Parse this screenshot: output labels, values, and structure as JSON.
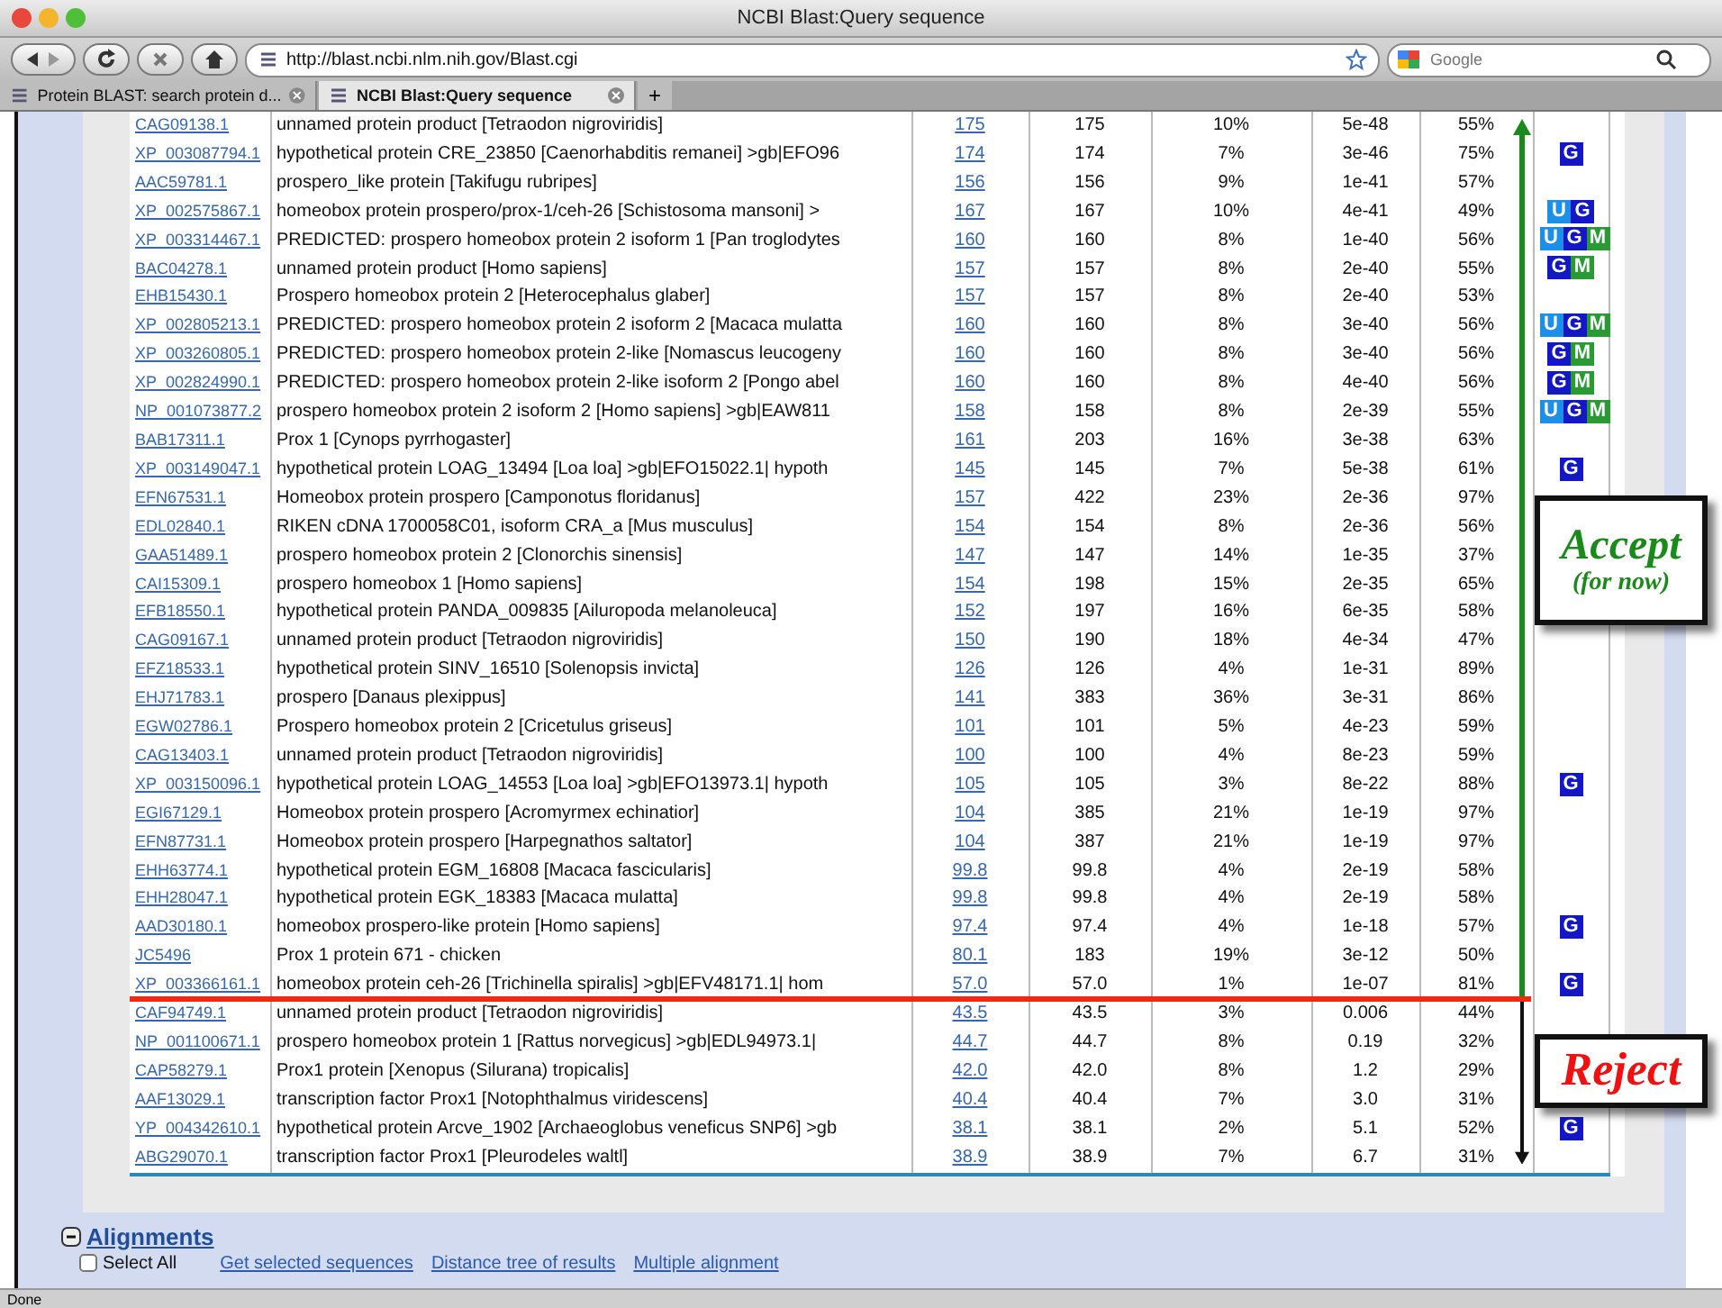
{
  "window": {
    "title": "NCBI Blast:Query sequence"
  },
  "toolbar": {
    "url": "http://blast.ncbi.nlm.nih.gov/Blast.cgi",
    "search_placeholder": "Google"
  },
  "tabs": [
    {
      "label": "Protein BLAST: search protein d...",
      "selected": false
    },
    {
      "label": "NCBI Blast:Query sequence",
      "selected": true
    }
  ],
  "new_tab": "+",
  "groups": [
    {
      "kind": "accept",
      "label": "Accept",
      "note": "(for now)",
      "rows": [
        {
          "accession": "CAG09138.1",
          "description": "unnamed protein product [Tetraodon nigroviridis]",
          "max_score": "175",
          "total_score": "175",
          "coverage": "10%",
          "evalue": "5e-48",
          "ident": "55%",
          "links": []
        },
        {
          "accession": "XP_003087794.1",
          "description": "hypothetical protein CRE_23850 [Caenorhabditis remanei] >gb|EFO96",
          "max_score": "174",
          "total_score": "174",
          "coverage": "7%",
          "evalue": "3e-46",
          "ident": "75%",
          "links": [
            {
              "kind": "gene",
              "label": "G"
            }
          ]
        },
        {
          "accession": "AAC59781.1",
          "description": "prospero_like protein [Takifugu rubripes]",
          "max_score": "156",
          "total_score": "156",
          "coverage": "9%",
          "evalue": "1e-41",
          "ident": "57%",
          "links": []
        },
        {
          "accession": "XP_002575867.1",
          "description": "homeobox protein prospero/prox-1/ceh-26 [Schistosoma mansoni] >",
          "max_score": "167",
          "total_score": "167",
          "coverage": "10%",
          "evalue": "4e-41",
          "ident": "49%",
          "links": [
            {
              "kind": "unigene",
              "label": "U"
            },
            {
              "kind": "gene",
              "label": "G"
            }
          ]
        },
        {
          "accession": "XP_003314467.1",
          "description": "PREDICTED: prospero homeobox protein 2 isoform 1 [Pan troglodytes",
          "max_score": "160",
          "total_score": "160",
          "coverage": "8%",
          "evalue": "1e-40",
          "ident": "56%",
          "links": [
            {
              "kind": "unigene",
              "label": "U"
            },
            {
              "kind": "gene",
              "label": "G"
            },
            {
              "kind": "map",
              "label": "M"
            }
          ]
        },
        {
          "accession": "BAC04278.1",
          "description": "unnamed protein product [Homo sapiens]",
          "max_score": "157",
          "total_score": "157",
          "coverage": "8%",
          "evalue": "2e-40",
          "ident": "55%",
          "links": [
            {
              "kind": "gene",
              "label": "G"
            },
            {
              "kind": "map",
              "label": "M"
            }
          ]
        },
        {
          "accession": "EHB15430.1",
          "description": "Prospero homeobox protein 2 [Heterocephalus glaber]",
          "max_score": "157",
          "total_score": "157",
          "coverage": "8%",
          "evalue": "2e-40",
          "ident": "53%",
          "links": []
        },
        {
          "accession": "XP_002805213.1",
          "description": "PREDICTED: prospero homeobox protein 2 isoform 2 [Macaca mulatta",
          "max_score": "160",
          "total_score": "160",
          "coverage": "8%",
          "evalue": "3e-40",
          "ident": "56%",
          "links": [
            {
              "kind": "unigene",
              "label": "U"
            },
            {
              "kind": "gene",
              "label": "G"
            },
            {
              "kind": "map",
              "label": "M"
            }
          ]
        },
        {
          "accession": "XP_003260805.1",
          "description": "PREDICTED: prospero homeobox protein 2-like [Nomascus leucogeny",
          "max_score": "160",
          "total_score": "160",
          "coverage": "8%",
          "evalue": "3e-40",
          "ident": "56%",
          "links": [
            {
              "kind": "gene",
              "label": "G"
            },
            {
              "kind": "map",
              "label": "M"
            }
          ]
        },
        {
          "accession": "XP_002824990.1",
          "description": "PREDICTED: prospero homeobox protein 2-like isoform 2 [Pongo abel",
          "max_score": "160",
          "total_score": "160",
          "coverage": "8%",
          "evalue": "4e-40",
          "ident": "56%",
          "links": [
            {
              "kind": "gene",
              "label": "G"
            },
            {
              "kind": "map",
              "label": "M"
            }
          ]
        },
        {
          "accession": "NP_001073877.2",
          "description": "prospero homeobox protein 2 isoform 2 [Homo sapiens] >gb|EAW811",
          "max_score": "158",
          "total_score": "158",
          "coverage": "8%",
          "evalue": "2e-39",
          "ident": "55%",
          "links": [
            {
              "kind": "unigene",
              "label": "U"
            },
            {
              "kind": "gene",
              "label": "G"
            },
            {
              "kind": "map",
              "label": "M"
            }
          ]
        },
        {
          "accession": "BAB17311.1",
          "description": "Prox 1 [Cynops pyrrhogaster]",
          "max_score": "161",
          "total_score": "203",
          "coverage": "16%",
          "evalue": "3e-38",
          "ident": "63%",
          "links": []
        },
        {
          "accession": "XP_003149047.1",
          "description": "hypothetical protein LOAG_13494 [Loa loa] >gb|EFO15022.1| hypoth",
          "max_score": "145",
          "total_score": "145",
          "coverage": "7%",
          "evalue": "5e-38",
          "ident": "61%",
          "links": [
            {
              "kind": "gene",
              "label": "G"
            }
          ]
        },
        {
          "accession": "EFN67531.1",
          "description": "Homeobox protein prospero [Camponotus floridanus]",
          "max_score": "157",
          "total_score": "422",
          "coverage": "23%",
          "evalue": "2e-36",
          "ident": "97%",
          "links": []
        },
        {
          "accession": "EDL02840.1",
          "description": "RIKEN cDNA 1700058C01, isoform CRA_a [Mus musculus]",
          "max_score": "154",
          "total_score": "154",
          "coverage": "8%",
          "evalue": "2e-36",
          "ident": "56%",
          "links": []
        },
        {
          "accession": "GAA51489.1",
          "description": "prospero homeobox protein 2 [Clonorchis sinensis]",
          "max_score": "147",
          "total_score": "147",
          "coverage": "14%",
          "evalue": "1e-35",
          "ident": "37%",
          "links": []
        },
        {
          "accession": "CAI15309.1",
          "description": "prospero homeobox 1 [Homo sapiens]",
          "max_score": "154",
          "total_score": "198",
          "coverage": "15%",
          "evalue": "2e-35",
          "ident": "65%",
          "links": []
        },
        {
          "accession": "EFB18550.1",
          "description": "hypothetical protein PANDA_009835 [Ailuropoda melanoleuca]",
          "max_score": "152",
          "total_score": "197",
          "coverage": "16%",
          "evalue": "6e-35",
          "ident": "58%",
          "links": []
        },
        {
          "accession": "CAG09167.1",
          "description": "unnamed protein product [Tetraodon nigroviridis]",
          "max_score": "150",
          "total_score": "190",
          "coverage": "18%",
          "evalue": "4e-34",
          "ident": "47%",
          "links": []
        },
        {
          "accession": "EFZ18533.1",
          "description": "hypothetical protein SINV_16510 [Solenopsis invicta]",
          "max_score": "126",
          "total_score": "126",
          "coverage": "4%",
          "evalue": "1e-31",
          "ident": "89%",
          "links": []
        },
        {
          "accession": "EHJ71783.1",
          "description": "prospero [Danaus plexippus]",
          "max_score": "141",
          "total_score": "383",
          "coverage": "36%",
          "evalue": "3e-31",
          "ident": "86%",
          "links": []
        },
        {
          "accession": "EGW02786.1",
          "description": "Prospero homeobox protein 2 [Cricetulus griseus]",
          "max_score": "101",
          "total_score": "101",
          "coverage": "5%",
          "evalue": "4e-23",
          "ident": "59%",
          "links": []
        },
        {
          "accession": "CAG13403.1",
          "description": "unnamed protein product [Tetraodon nigroviridis]",
          "max_score": "100",
          "total_score": "100",
          "coverage": "4%",
          "evalue": "8e-23",
          "ident": "59%",
          "links": []
        },
        {
          "accession": "XP_003150096.1",
          "description": "hypothetical protein LOAG_14553 [Loa loa] >gb|EFO13973.1| hypoth",
          "max_score": "105",
          "total_score": "105",
          "coverage": "3%",
          "evalue": "8e-22",
          "ident": "88%",
          "links": [
            {
              "kind": "gene",
              "label": "G"
            }
          ]
        },
        {
          "accession": "EGI67129.1",
          "description": "Homeobox protein prospero [Acromyrmex echinatior]",
          "max_score": "104",
          "total_score": "385",
          "coverage": "21%",
          "evalue": "1e-19",
          "ident": "97%",
          "links": []
        },
        {
          "accession": "EFN87731.1",
          "description": "Homeobox protein prospero [Harpegnathos saltator]",
          "max_score": "104",
          "total_score": "387",
          "coverage": "21%",
          "evalue": "1e-19",
          "ident": "97%",
          "links": []
        },
        {
          "accession": "EHH63774.1",
          "description": "hypothetical protein EGM_16808 [Macaca fascicularis]",
          "max_score": "99.8",
          "total_score": "99.8",
          "coverage": "4%",
          "evalue": "2e-19",
          "ident": "58%",
          "links": []
        },
        {
          "accession": "EHH28047.1",
          "description": "hypothetical protein EGK_18383 [Macaca mulatta]",
          "max_score": "99.8",
          "total_score": "99.8",
          "coverage": "4%",
          "evalue": "2e-19",
          "ident": "58%",
          "links": []
        },
        {
          "accession": "AAD30180.1",
          "description": "homeobox prospero-like protein [Homo sapiens]",
          "max_score": "97.4",
          "total_score": "97.4",
          "coverage": "4%",
          "evalue": "1e-18",
          "ident": "57%",
          "links": [
            {
              "kind": "gene",
              "label": "G"
            }
          ]
        },
        {
          "accession": "JC5496",
          "description": "Prox 1 protein 671 - chicken",
          "max_score": "80.1",
          "total_score": "183",
          "coverage": "19%",
          "evalue": "3e-12",
          "ident": "50%",
          "links": []
        },
        {
          "accession": "XP_003366161.1",
          "description": "homeobox protein ceh-26 [Trichinella spiralis] >gb|EFV48171.1| hom",
          "max_score": "57.0",
          "total_score": "57.0",
          "coverage": "1%",
          "evalue": "1e-07",
          "ident": "81%",
          "links": [
            {
              "kind": "gene",
              "label": "G"
            }
          ]
        }
      ]
    },
    {
      "kind": "reject",
      "label": "Reject",
      "rows": [
        {
          "accession": "CAF94749.1",
          "description": "unnamed protein product [Tetraodon nigroviridis]",
          "max_score": "43.5",
          "total_score": "43.5",
          "coverage": "3%",
          "evalue": "0.006",
          "ident": "44%",
          "links": []
        },
        {
          "accession": "NP_001100671.1",
          "description": "prospero homeobox protein 1 [Rattus norvegicus] >gb|EDL94973.1|",
          "max_score": "44.7",
          "total_score": "44.7",
          "coverage": "8%",
          "evalue": "0.19",
          "ident": "32%",
          "links": []
        },
        {
          "accession": "CAP58279.1",
          "description": "Prox1 protein [Xenopus (Silurana) tropicalis]",
          "max_score": "42.0",
          "total_score": "42.0",
          "coverage": "8%",
          "evalue": "1.2",
          "ident": "29%",
          "links": []
        },
        {
          "accession": "AAF13029.1",
          "description": "transcription factor Prox1 [Notophthalmus viridescens]",
          "max_score": "40.4",
          "total_score": "40.4",
          "coverage": "7%",
          "evalue": "3.0",
          "ident": "31%",
          "links": []
        },
        {
          "accession": "YP_004342610.1",
          "description": "hypothetical protein Arcve_1902 [Archaeoglobus veneficus SNP6] >gb",
          "max_score": "38.1",
          "total_score": "38.1",
          "coverage": "2%",
          "evalue": "5.1",
          "ident": "52%",
          "links": [
            {
              "kind": "gene",
              "label": "G"
            }
          ]
        },
        {
          "accession": "ABG29070.1",
          "description": "transcription factor Prox1 [Pleurodeles waltl]",
          "max_score": "38.9",
          "total_score": "38.9",
          "coverage": "7%",
          "evalue": "6.7",
          "ident": "31%",
          "links": []
        }
      ]
    }
  ],
  "alignments": {
    "title": "Alignments",
    "expanded": true,
    "select_all": {
      "label": "Select All",
      "checked": false
    },
    "actions": [
      "Get selected sequences",
      "Distance tree of results",
      "Multiple alignment"
    ]
  },
  "status_bar": {
    "text": "Done"
  }
}
